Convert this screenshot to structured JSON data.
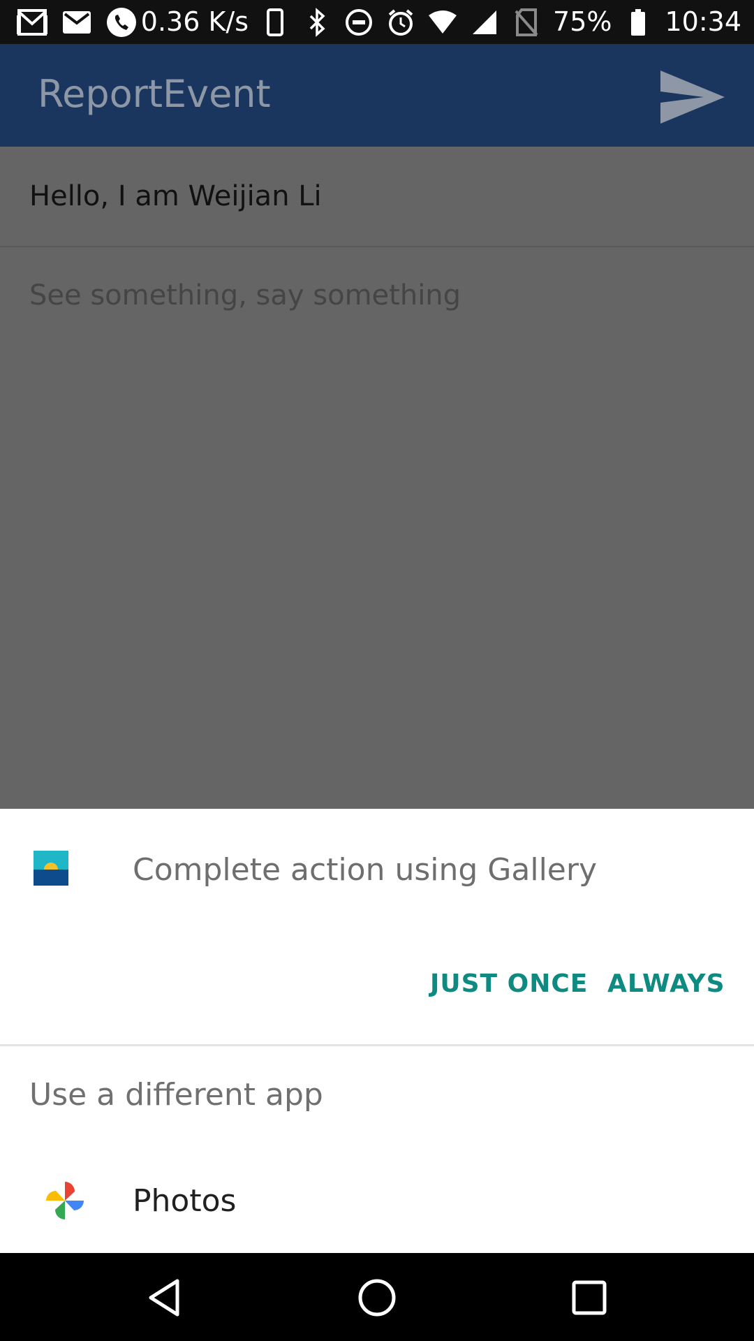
{
  "status_bar": {
    "net_speed": "0.36 K/s",
    "battery": "75%",
    "time": "10:34",
    "icons": [
      "gmail-icon",
      "mail-icon",
      "phone-icon",
      "device-icon",
      "bluetooth-icon",
      "dnd-icon",
      "alarm-icon",
      "wifi-icon",
      "signal-icon",
      "no-sim-icon",
      "battery-icon"
    ]
  },
  "app_bar": {
    "title": "ReportEvent",
    "send_icon": "send-icon"
  },
  "form": {
    "name_value": "Hello, I am Weijian Li",
    "report_placeholder": "See something, say something"
  },
  "chooser": {
    "title": "Complete action using Gallery",
    "just_once": "JUST ONCE",
    "always": "ALWAYS",
    "different_app": "Use a different app",
    "app_name": "Photos"
  },
  "colors": {
    "app_bar": "#1a355e",
    "accent": "#0e8a80"
  }
}
